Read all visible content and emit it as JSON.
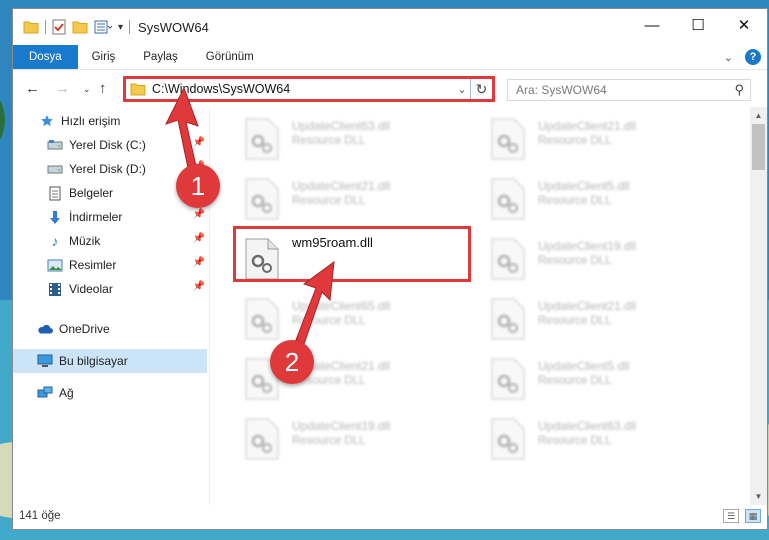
{
  "window": {
    "title": "SysWOW64",
    "controls": {
      "minimize": "—",
      "maximize": "☐",
      "close": "✕"
    }
  },
  "ribbon": {
    "tabs": [
      {
        "label": "Dosya",
        "active": true
      },
      {
        "label": "Giriş"
      },
      {
        "label": "Paylaş"
      },
      {
        "label": "Görünüm"
      }
    ]
  },
  "address": {
    "path": "C:\\Windows\\SysWOW64",
    "search_placeholder": "Ara: SysWOW64"
  },
  "sidebar": {
    "items": [
      {
        "label": "Hızlı erişim",
        "icon": "star-icon"
      },
      {
        "label": "Yerel Disk (C:)",
        "icon": "drive-icon",
        "pinned": true
      },
      {
        "label": "Yerel Disk (D:)",
        "icon": "drive-icon",
        "pinned": true
      },
      {
        "label": "Belgeler",
        "icon": "document-icon",
        "pinned": true
      },
      {
        "label": "İndirmeler",
        "icon": "download-icon",
        "pinned": true
      },
      {
        "label": "Müzik",
        "icon": "music-icon",
        "pinned": true
      },
      {
        "label": "Resimler",
        "icon": "pictures-icon",
        "pinned": true
      },
      {
        "label": "Videolar",
        "icon": "video-icon",
        "pinned": true
      },
      {
        "label": "OneDrive",
        "icon": "cloud-icon"
      },
      {
        "label": "Bu bilgisayar",
        "icon": "computer-icon",
        "selected": true
      },
      {
        "label": "Ağ",
        "icon": "network-icon"
      }
    ]
  },
  "files": [
    {
      "name": "UpdateClient63.dll",
      "type": "Resource DLL"
    },
    {
      "name": "UpdateClient21.dll",
      "type": "Resource DLL"
    },
    {
      "name": "UpdateClient21.dll",
      "type": "Resource DLL"
    },
    {
      "name": "UpdateClient5.dll",
      "type": "Resource DLL"
    },
    {
      "name": "wm95roam.dll",
      "type": ""
    },
    {
      "name": "UpdateClient19.dll",
      "type": "Resource DLL"
    },
    {
      "name": "UpdateClient65.dll",
      "type": "Resource DLL"
    },
    {
      "name": "UpdateClient21.dll",
      "type": "Resource DLL"
    },
    {
      "name": "UpdateClient21.dll",
      "type": "Resource DLL"
    },
    {
      "name": "UpdateClient5.dll",
      "type": "Resource DLL"
    },
    {
      "name": "UpdateClient19.dll",
      "type": "Resource DLL"
    },
    {
      "name": "UpdateClient63.dll",
      "type": "Resource DLL"
    }
  ],
  "status": {
    "item_count": "141 öğe"
  },
  "callouts": [
    "1",
    "2"
  ],
  "colors": {
    "accent": "#1979ca",
    "highlight": "#e0393c",
    "selection": "#cce4f7"
  }
}
